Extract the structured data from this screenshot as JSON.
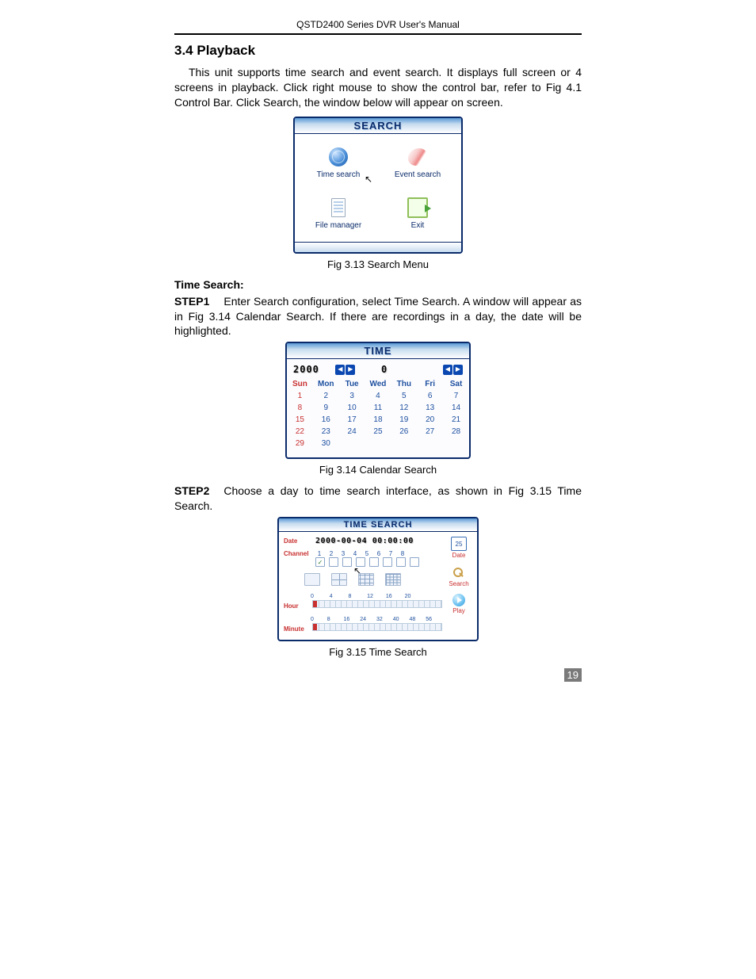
{
  "running_head": "QSTD2400 Series DVR User's Manual",
  "section_title": "3.4  Playback",
  "intro": "This unit supports time search and event search. It displays full screen or 4 screens in playback. Click right mouse to show the control bar, refer to Fig 4.1 Control Bar. Click Search, the window below will appear on screen.",
  "fig_313": {
    "title": "SEARCH",
    "time_search": "Time search",
    "event_search": "Event search",
    "file_manager": "File manager",
    "exit": "Exit",
    "caption": "Fig 3.13    Search Menu"
  },
  "time_search_head": "Time Search:",
  "step1_label": "STEP1",
  "step1_text": "Enter Search configuration, select Time Search. A window will appear as in Fig 3.14 Calendar Search. If there are recordings in a day, the date will be highlighted.",
  "fig_314": {
    "title": "TIME",
    "year": "2000",
    "month": "0",
    "days_head": [
      "Sun",
      "Mon",
      "Tue",
      "Wed",
      "Thu",
      "Fri",
      "Sat"
    ],
    "rows": [
      [
        "1",
        "2",
        "3",
        "4",
        "5",
        "6",
        "7"
      ],
      [
        "8",
        "9",
        "10",
        "11",
        "12",
        "13",
        "14"
      ],
      [
        "15",
        "16",
        "17",
        "18",
        "19",
        "20",
        "21"
      ],
      [
        "22",
        "23",
        "24",
        "25",
        "26",
        "27",
        "28"
      ],
      [
        "29",
        "30",
        "",
        "",
        "",
        "",
        ""
      ]
    ],
    "caption": "Fig 3.14 Calendar Search"
  },
  "step2_label": "STEP2",
  "step2_text": "Choose a day to time search interface, as shown in Fig 3.15 Time Search.",
  "fig_315": {
    "title": "TIME SEARCH",
    "date_label": "Date",
    "date_value": "2000-00-04 00:00:00",
    "channel_label": "Channel",
    "channels": [
      "1",
      "2",
      "3",
      "4",
      "5",
      "6",
      "7",
      "8"
    ],
    "hour_label": "Hour",
    "hour_ticks": [
      "0",
      "4",
      "8",
      "12",
      "16",
      "20",
      ""
    ],
    "minute_label": "Minute",
    "minute_ticks": [
      "0",
      "8",
      "16",
      "24",
      "32",
      "40",
      "48",
      "56"
    ],
    "side": {
      "date_num": "25",
      "date": "Date",
      "search": "Search",
      "play": "Play"
    },
    "caption": "Fig 3.15 Time Search"
  },
  "page_number": "19"
}
